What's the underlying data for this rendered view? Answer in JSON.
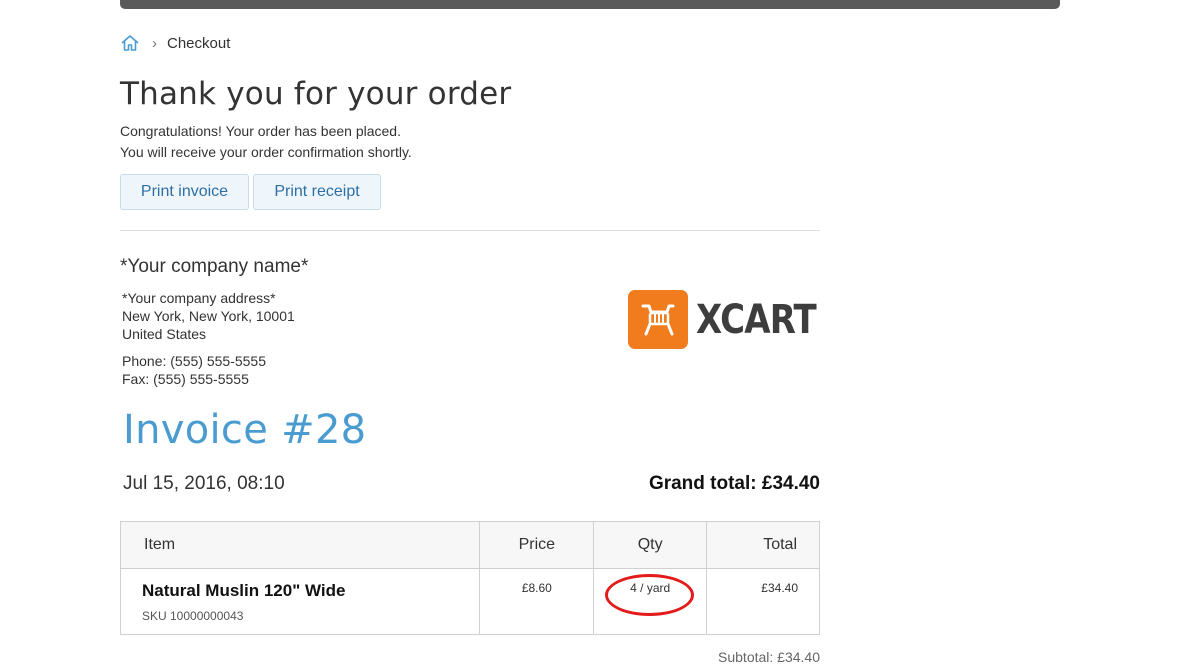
{
  "breadcrumb": {
    "home_icon": "home-icon",
    "separator": "›",
    "current": "Checkout"
  },
  "page": {
    "title": "Thank you for your order",
    "congrats_line1": "Congratulations! Your order has been placed.",
    "congrats_line2": "You will receive your order confirmation shortly."
  },
  "actions": {
    "print_invoice": "Print invoice",
    "print_receipt": "Print receipt"
  },
  "company": {
    "name": "*Your company name*",
    "address": "*Your company address*",
    "city_line": "New York, New York, 10001",
    "country": "United States",
    "phone": "Phone: (555) 555-5555",
    "fax": "Fax: (555) 555-5555",
    "logo_text": "XCART",
    "logo_color": "#f07c1d"
  },
  "invoice": {
    "title": "Invoice #28",
    "date": "Jul 15, 2016, 08:10",
    "grand_total": "Grand total: £34.40",
    "accent_color": "#4a9cd0",
    "columns": [
      "Item",
      "Price",
      "Qty",
      "Total"
    ],
    "rows": [
      {
        "name": "Natural Muslin 120\" Wide",
        "sku": "SKU 10000000043",
        "price": "£8.60",
        "qty": "4 / yard",
        "total": "£34.40"
      }
    ],
    "subtotal": "Subtotal: £34.40",
    "annotation_color": "#e31b1b"
  }
}
